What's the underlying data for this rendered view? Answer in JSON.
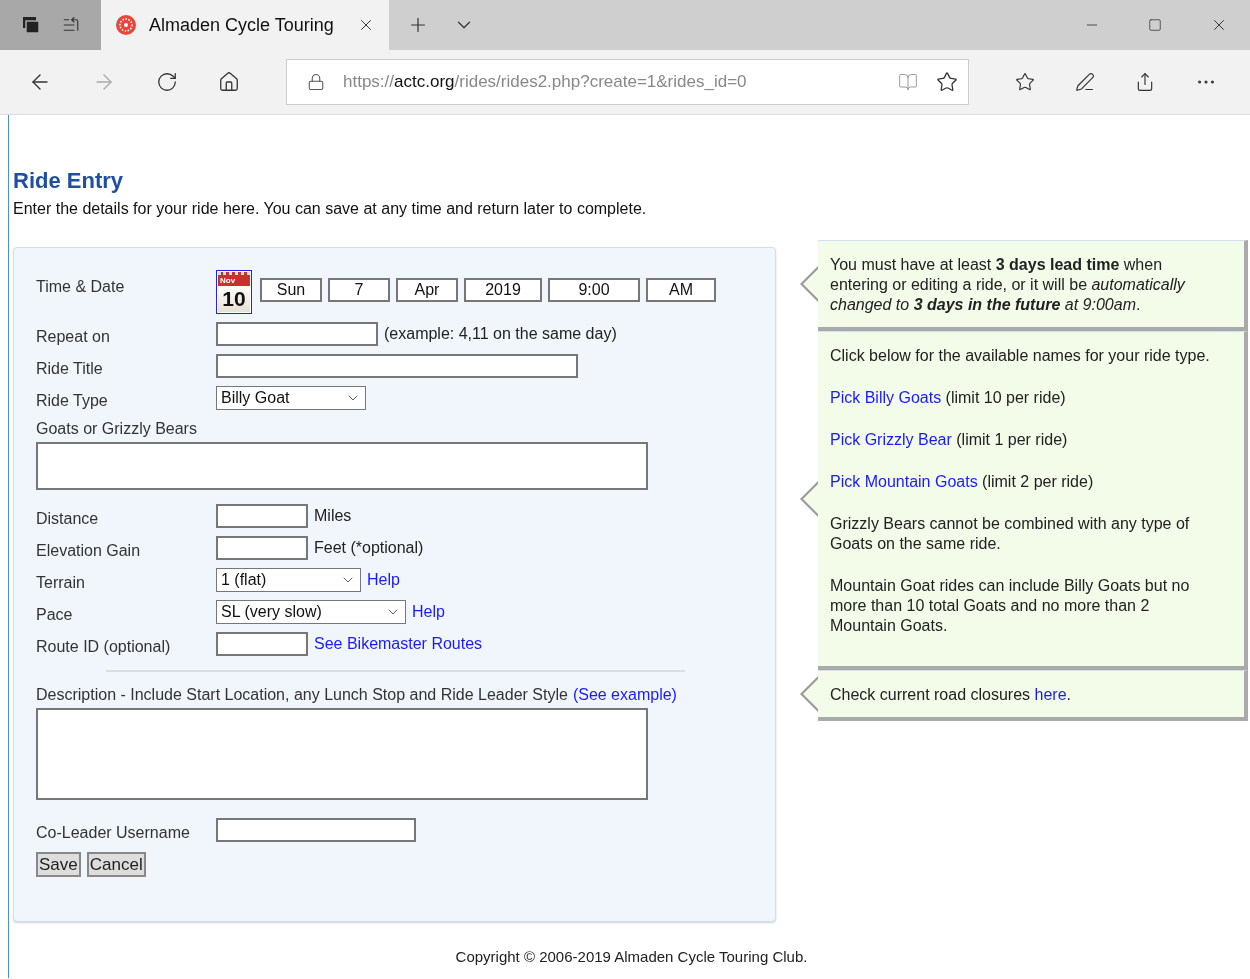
{
  "browser": {
    "tab_title": "Almaden Cycle Touring",
    "address": {
      "scheme": "https://",
      "domain": "actc.org",
      "path": "/rides/rides2.php?create=1&rides_id=0"
    }
  },
  "page": {
    "title": "Ride Entry",
    "intro": "Enter the details for your ride here. You can save at any time and return later to complete."
  },
  "form": {
    "rows": [
      {
        "kind": "datetime",
        "label": "Time & Date",
        "calendar": {
          "month": "Nov",
          "day": "10"
        },
        "parts": [
          "Sun",
          "7",
          "Apr",
          "2019",
          "9:00",
          "AM"
        ]
      },
      {
        "kind": "text",
        "label": "Repeat on",
        "after": "(example: 4,11 on the same day)"
      },
      {
        "kind": "text",
        "label": "Ride Title"
      },
      {
        "kind": "select",
        "label": "Ride Type",
        "value": "Billy Goat"
      },
      {
        "kind": "area",
        "label": "Goats or Grizzly Bears"
      },
      {
        "kind": "text",
        "label": "Distance",
        "after": "Miles"
      },
      {
        "kind": "text",
        "label": "Elevation Gain",
        "after": "Feet (*optional)"
      },
      {
        "kind": "select",
        "label": "Terrain",
        "value": "1 (flat)",
        "link": "Help"
      },
      {
        "kind": "select",
        "label": "Pace",
        "value": "SL (very slow)",
        "link": "Help"
      },
      {
        "kind": "text",
        "label": "Route ID (optional)",
        "link": "See Bikemaster Routes"
      },
      {
        "kind": "divider"
      },
      {
        "kind": "area",
        "label": "Description - Include Start Location, any Lunch Stop and Ride Leader Style",
        "link": "(See example)"
      },
      {
        "kind": "text",
        "label": "Co-Leader Username"
      }
    ],
    "buttons": [
      "Save",
      "Cancel"
    ]
  },
  "notes": [
    {
      "paragraphs": [
        [
          {
            "text": "You must have at least **3 days lead time** when entering or editing a ride, or it will be *automatically changed to* **3 days in the future** *at 9:00am*."
          }
        ]
      ]
    },
    {
      "paragraphs": [
        [
          {
            "text": "Click below for the available names for your ride type."
          }
        ],
        [
          {
            "link": "Pick Billy Goats"
          },
          {
            "text": " (limit 10 per ride)"
          }
        ],
        [
          {
            "link": "Pick Grizzly Bear"
          },
          {
            "text": " (limit 1 per ride)"
          }
        ],
        [
          {
            "link": "Pick Mountain Goats"
          },
          {
            "text": " (limit 2 per ride)"
          }
        ],
        [
          {
            "text": "Grizzly Bears cannot be combined with any type of Goats on the same ride."
          }
        ],
        [
          {
            "text": "Mountain Goat rides can include Billy Goats but no more than 10 total Goats and no more than 2 Mountain Goats."
          }
        ]
      ]
    },
    {
      "paragraphs": [
        [
          {
            "text": "Check current road closures "
          },
          {
            "link": "here"
          },
          {
            "text": "."
          }
        ]
      ]
    }
  ],
  "footer": "Copyright © 2006-2019 Almaden Cycle Touring Club."
}
